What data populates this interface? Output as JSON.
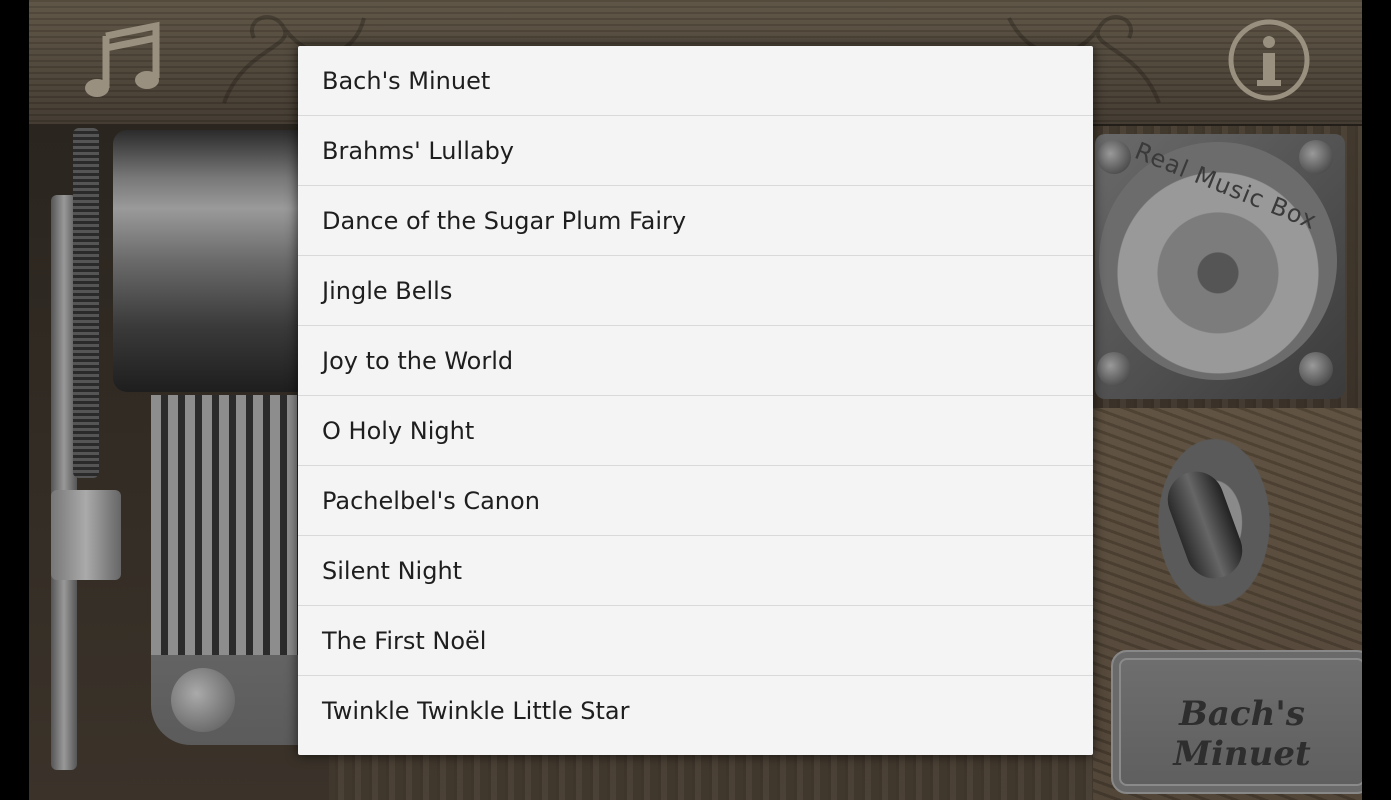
{
  "app": {
    "bell_label": "Real Music Box",
    "nameplate_label": "Bach's Minuet"
  },
  "toolbar": {
    "left_icon": "music-note-icon",
    "right_icon": "info-icon"
  },
  "song_dialog": {
    "items": [
      {
        "label": "Bach's Minuet"
      },
      {
        "label": "Brahms' Lullaby"
      },
      {
        "label": "Dance of the Sugar Plum Fairy"
      },
      {
        "label": "Jingle Bells"
      },
      {
        "label": "Joy to the World"
      },
      {
        "label": "O Holy Night"
      },
      {
        "label": "Pachelbel's Canon"
      },
      {
        "label": "Silent Night"
      },
      {
        "label": "The First Noël"
      },
      {
        "label": "Twinkle Twinkle Little Star"
      }
    ]
  },
  "colors": {
    "dialog_bg": "#f4f4f4",
    "divider": "#d9d9d9",
    "text": "#1e1e1e",
    "wood": "#4b4236"
  }
}
